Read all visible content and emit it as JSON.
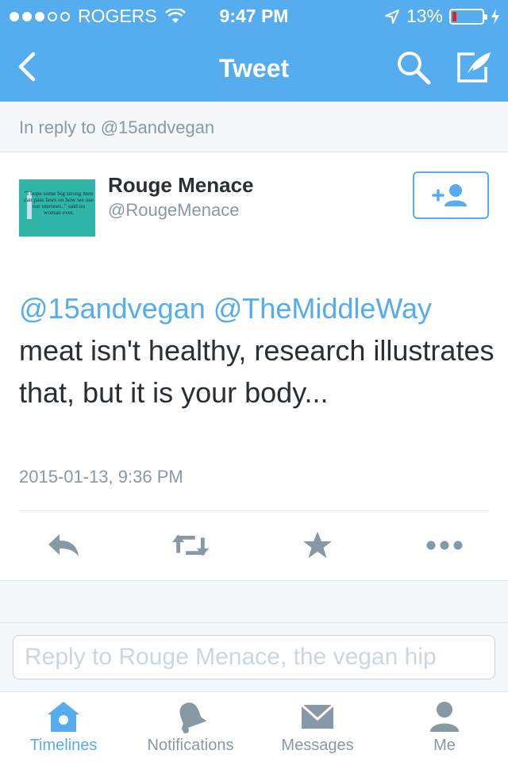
{
  "status_bar": {
    "carrier": "ROGERS",
    "time": "9:47 PM",
    "battery_percent": "13%",
    "battery_level": 0.13,
    "signal_bars_filled": 3,
    "signal_bars_total": 5
  },
  "nav": {
    "title": "Tweet",
    "icons": [
      "back-chevron-icon",
      "search-icon",
      "compose-tweet-icon"
    ]
  },
  "reply_header": {
    "text": "In reply to @15andvegan"
  },
  "tweet": {
    "author_name": "Rouge Menace",
    "author_handle": "@RougeMenace",
    "avatar_text": "\"I hope some big strong men can pass laws on how we use our uteruses..\" said no woman ever.",
    "mention_1": "@15andvegan",
    "mention_2": "@TheMiddleWay",
    "body": "meat isn't healthy, research illustrates that, but it is your body...",
    "timestamp": "2015-01-13, 9:36 PM"
  },
  "actions": [
    "reply-icon",
    "retweet-icon",
    "favorite-star-icon",
    "more-dots-icon"
  ],
  "reply_box": {
    "placeholder": "Reply to Rouge Menace, the vegan hip"
  },
  "tabbar": {
    "items": [
      {
        "label": "Timelines",
        "icon": "home-icon",
        "active": true
      },
      {
        "label": "Notifications",
        "icon": "bell-icon",
        "active": false
      },
      {
        "label": "Messages",
        "icon": "envelope-icon",
        "active": false
      },
      {
        "label": "Me",
        "icon": "person-icon",
        "active": false
      }
    ]
  },
  "colors": {
    "brand": "#55acee",
    "text": "#292f33",
    "muted": "#8899a6",
    "battery_low": "#e0241b"
  }
}
